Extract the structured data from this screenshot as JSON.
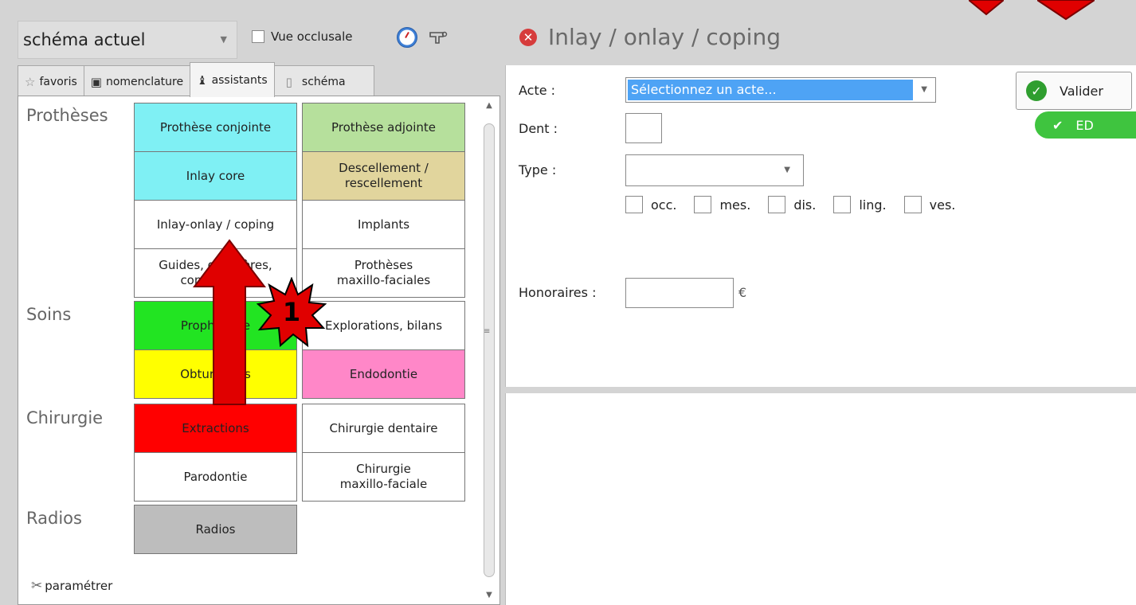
{
  "header": {
    "view_select": "schéma actuel",
    "vue_occlusale_label": "Vue occlusale"
  },
  "tabs": [
    {
      "label": "favoris",
      "icon": "star-icon"
    },
    {
      "label": "nomenclature",
      "icon": "book-icon"
    },
    {
      "label": "assistants",
      "icon": "wizard-icon",
      "active": true
    },
    {
      "label": "schéma",
      "icon": "tooth-icon"
    }
  ],
  "categories": {
    "protheses": "Prothèses",
    "soins": "Soins",
    "chirurgie": "Chirurgie",
    "radios": "Radios"
  },
  "cells": {
    "prothese_conjointe": "Prothèse conjointe",
    "prothese_adjointe": "Prothèse adjointe",
    "inlay_core": "Inlay core",
    "descellement_1": "Descellement /",
    "descellement_2": "rescellement",
    "inlay_onlay": "Inlay-onlay / coping",
    "implants": "Implants",
    "guides_1": "Guides, gouttières,",
    "guides_2": "contentions",
    "protheses_mf_1": "Prothèses",
    "protheses_mf_2": "maxillo-faciales",
    "prophylaxie": "Prophylaxie",
    "explorations": "Explorations, bilans",
    "obturations": "Obturations",
    "endodontie": "Endodontie",
    "extractions": "Extractions",
    "chirurgie_dentaire": "Chirurgie dentaire",
    "parodontie": "Parodontie",
    "chirurgie_mf_1": "Chirurgie",
    "chirurgie_mf_2": "maxillo-faciale",
    "radios": "Radios"
  },
  "colors": {
    "cyan": "#7ff0f4",
    "light_green": "#b6e09c",
    "tan": "#e1d59d",
    "green": "#22e422",
    "yellow": "#ffff00",
    "pink": "#ff87c8",
    "red": "#ff0000",
    "grey": "#bdbdbd",
    "selection_blue": "#4ea3f5",
    "annotation_red": "#e00000"
  },
  "parametrer_label": "paramétrer",
  "annotation": {
    "step_number": "1"
  },
  "form": {
    "title": "Inlay / onlay / coping",
    "acte_label": "Acte :",
    "acte_value": "Sélectionnez un acte...",
    "dent_label": "Dent :",
    "type_label": "Type :",
    "faces": [
      "occ.",
      "mes.",
      "dis.",
      "ling.",
      "ves."
    ],
    "honoraires_label": "Honoraires :",
    "currency": "€",
    "valider_label": "Valider",
    "ed_label": "ED"
  }
}
